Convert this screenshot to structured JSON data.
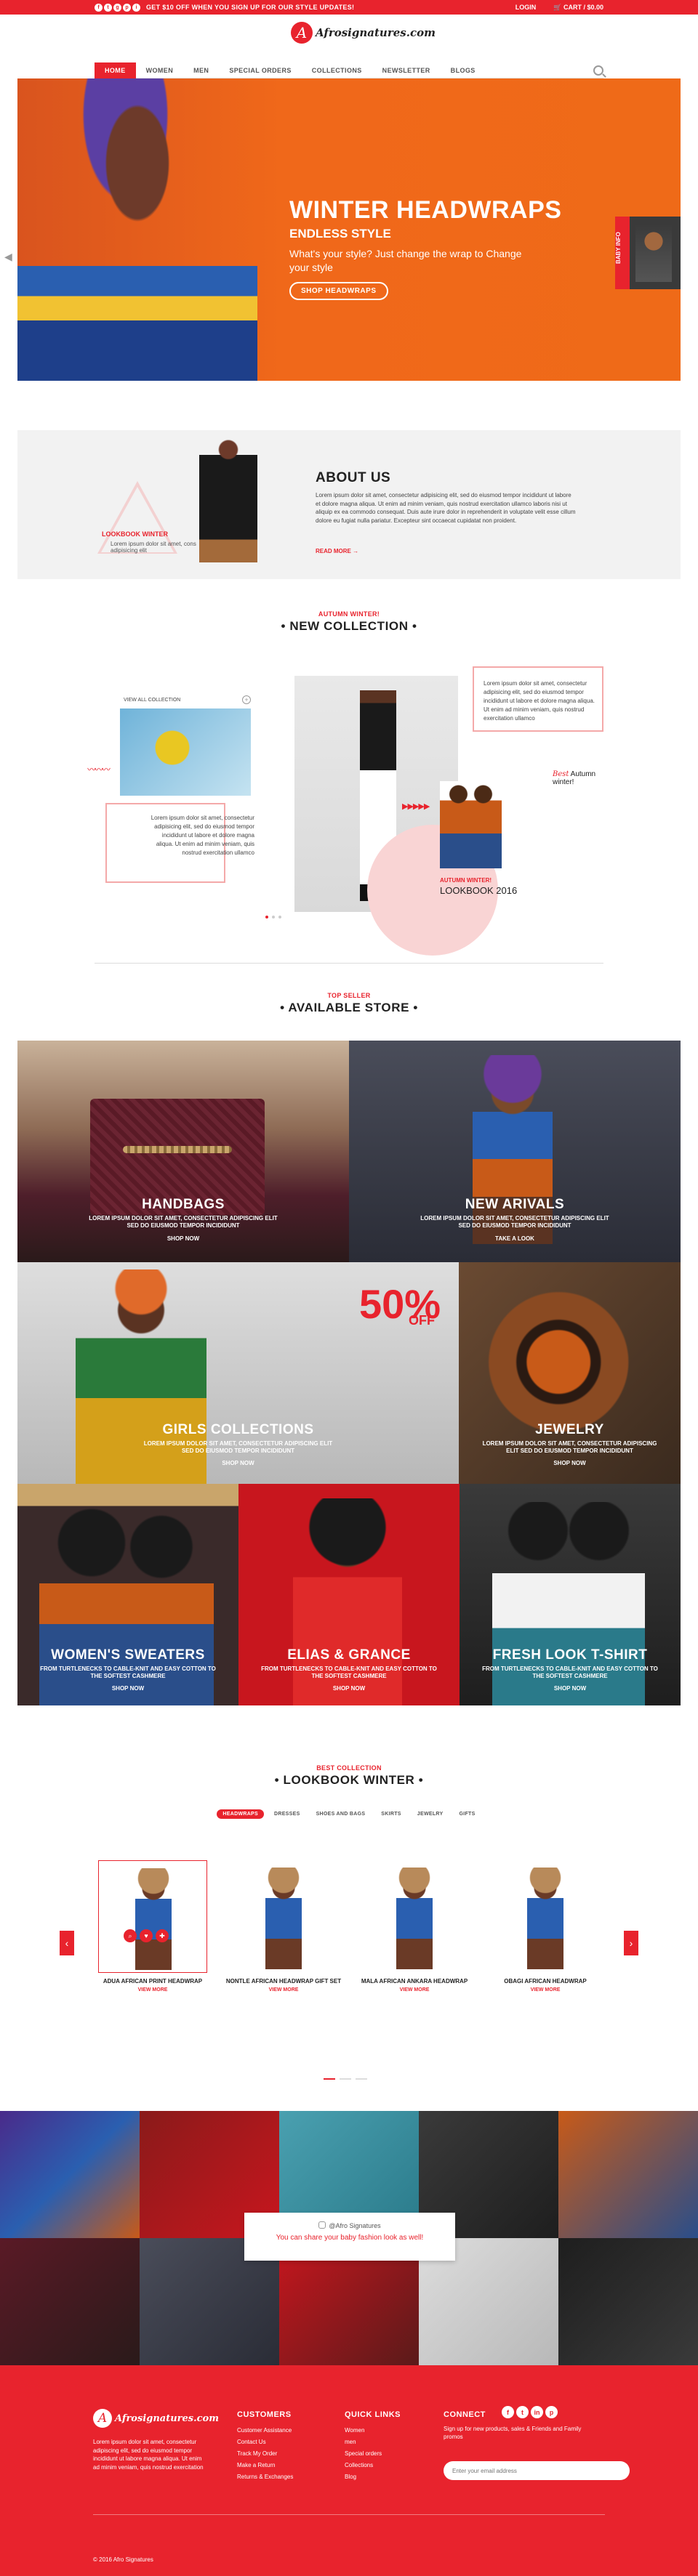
{
  "topbar": {
    "social": [
      "f",
      "t",
      "g",
      "p",
      "i"
    ],
    "promo": "GET $10 OFF WHEN YOU SIGN UP FOR OUR STYLE UPDATES!",
    "login": "LOGIN",
    "cart": "CART / $0.00"
  },
  "logo": {
    "mark": "A",
    "text": "Afrosignatures.com"
  },
  "nav": {
    "items": [
      "HOME",
      "WOMEN",
      "MEN",
      "SPECIAL ORDERS",
      "COLLECTIONS",
      "NEWSLETTER",
      "BLOGS"
    ],
    "active": "HOME"
  },
  "hero": {
    "title": "WINTER HEADWRAPS",
    "subtitle": "ENDLESS STYLE",
    "text": "What's your style? Just change the wrap to Change your style",
    "button": "SHOP HEADWRAPS",
    "side_label": "BABY INFO"
  },
  "about": {
    "title": "ABOUT US",
    "text": "Lorem ipsum dolor sit amet, consectetur adipisicing elit, sed do eiusmod tempor incididunt ut labore et dolore magna aliqua. Ut enim ad minim veniam, quis nostrud exercitation ullamco laboris nisi ut aliquip ex ea commodo consequat. Duis aute irure dolor in reprehenderit in voluptate velit esse cillum dolore eu fugiat nulla pariatur. Excepteur sint occaecat cupidatat non proident.",
    "read_more": "READ MORE",
    "lookbook_label": "LOOKBOOK WINTER",
    "lookbook_text": "Lorem ipsum dolor sit amet, cons adipisicing elit"
  },
  "new_collection": {
    "sub": "AUTUMN WINTER!",
    "title": "NEW COLLECTION",
    "view_all": "VIEW ALL COLLECTION",
    "text_left": "Lorem ipsum dolor sit amet, consectetur adipisicing elit, sed do eiusmod tempor incididunt ut labore et dolore magna aliqua. Ut enim ad minim veniam, quis nostrud exercitation ullamco",
    "text_right": "Lorem ipsum dolor sit amet, consectetur adipisicing elit, sed do eiusmod tempor incididunt ut labore et dolore magna aliqua. Ut enim ad minim veniam, quis nostrud exercitation ullamco",
    "best": "Best",
    "best_rest": "Autumn winter!",
    "lookbook_sub": "AUTUMN WINTER!",
    "lookbook": "LOOKBOOK 2016"
  },
  "store": {
    "sub": "TOP SELLER",
    "title": "AVAILABLE STORE",
    "tiles": [
      {
        "name": "HANDBAGS",
        "desc": "LOREM IPSUM DOLOR SIT AMET, CONSECTETUR ADIPISCING ELIT SED DO EIUSMOD TEMPOR INCIDIDUNT",
        "shop": "SHOP NOW"
      },
      {
        "name": "NEW ARIVALS",
        "desc": "LOREM IPSUM DOLOR SIT AMET, CONSECTETUR ADIPISCING ELIT SED DO EIUSMOD TEMPOR INCIDIDUNT",
        "shop": "TAKE A LOOK"
      },
      {
        "name": "GIRLS COLLECTIONS",
        "desc": "LOREM IPSUM DOLOR SIT AMET, CONSECTETUR ADIPISCING ELIT SED DO EIUSMOD TEMPOR INCIDIDUNT",
        "shop": "SHOP NOW"
      },
      {
        "name": "JEWELRY",
        "desc": "LOREM IPSUM DOLOR SIT AMET, CONSECTETUR ADIPISCING ELIT SED DO EIUSMOD TEMPOR INCIDIDUNT",
        "shop": "SHOP NOW"
      },
      {
        "name": "WOMEN'S SWEATERS",
        "desc": "FROM TURTLENECKS TO CABLE-KNIT AND EASY COTTON TO THE SOFTEST CASHMERE",
        "shop": "SHOP NOW"
      },
      {
        "name": "ELIAS & GRANCE",
        "desc": "FROM TURTLENECKS TO CABLE-KNIT AND EASY COTTON TO THE SOFTEST CASHMERE",
        "shop": "SHOP NOW"
      },
      {
        "name": "FRESH LOOK T-SHIRT",
        "desc": "FROM TURTLENECKS TO CABLE-KNIT AND EASY COTTON TO THE SOFTEST CASHMERE",
        "shop": "SHOP NOW"
      }
    ],
    "sale_pct": "50%",
    "sale_off": "OFF"
  },
  "lookbook": {
    "sub": "BEST COLLECTION",
    "title": "LOOKBOOK WINTER",
    "tabs": [
      "HEADWRAPS",
      "DRESSES",
      "SHOES AND BAGS",
      "SKIRTS",
      "JEWELRY",
      "GIFTS"
    ],
    "active_tab": "HEADWRAPS",
    "products": [
      {
        "name": "ADUA AFRICAN PRINT HEADWRAP",
        "view": "VIEW MORE"
      },
      {
        "name": "NONTLE AFRICAN HEADWRAP GIFT SET",
        "view": "VIEW MORE"
      },
      {
        "name": "MALA AFRICAN ANKARA HEADWRAP",
        "view": "VIEW MORE"
      },
      {
        "name": "OBAGI AFRICAN HEADWRAP",
        "view": "VIEW MORE"
      }
    ]
  },
  "instagram": {
    "handle": "@Afro Signatures",
    "text": "You can share your baby fashion look as well!"
  },
  "footer": {
    "logo_text": "Afrosignatures.com",
    "about": "Lorem ipsum dolor sit amet, consectetur adipiscing elit, sed do eiusmod tempor incididunt ut labore magna aliqua. Ut enim ad minim veniam, quis nostrud exercitation",
    "customers_title": "CUSTOMERS",
    "customers": [
      "Customer Assistance",
      "Contact Us",
      "Track My Order",
      "Make a Return",
      "Returns & Exchanges"
    ],
    "quick_title": "QUICK LINKS",
    "quick": [
      "Women",
      "men",
      "Special orders",
      "Collections",
      "Blog"
    ],
    "connect_title": "CONNECT",
    "social": [
      "f",
      "t",
      "in",
      "p"
    ],
    "signup": "Sign up for new products, sales & Friends and Family promos",
    "email_placeholder": "Enter your email address",
    "copyright": "© 2016 Afro Signatures"
  }
}
